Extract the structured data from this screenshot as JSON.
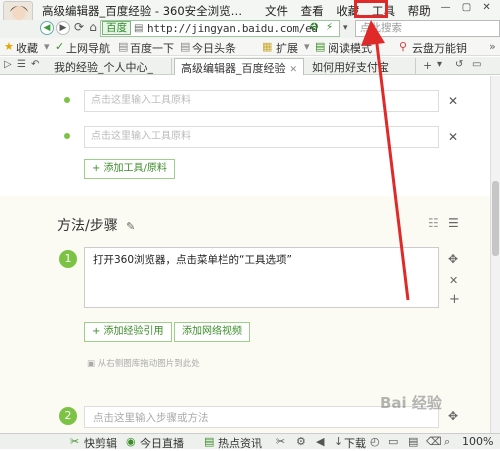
{
  "window": {
    "title": "高级编辑器_百度经验 - 360安全浏览…",
    "menu": [
      "文件",
      "查看",
      "收藏",
      "工具",
      "帮助"
    ],
    "controls": "▭ — ▢ ✕"
  },
  "address_bar": {
    "site_tag": "百度",
    "url": "http://jingyan.baidu.com/ed",
    "search_placeholder": "点此搜索"
  },
  "bookmarks": {
    "favorites": "收藏",
    "items": [
      "上网导航",
      "百度一下",
      "今日头条"
    ],
    "extensions": "扩展",
    "reading_mode": "阅读模式",
    "cloud": "云盘万能钥"
  },
  "tabs": [
    {
      "label": "我的经验_个人中心_"
    },
    {
      "label": "高级编辑器_百度经验",
      "active": true
    },
    {
      "label": "如何用好支付宝"
    }
  ],
  "editor": {
    "tool_placeholder": "点击这里输入工具原料",
    "add_tool": "+ 添加工具/原料",
    "method_title": "方法/步骤",
    "steps": [
      {
        "num": "1",
        "text": "打开360浏览器，点击菜单栏的“工具选项”"
      },
      {
        "num": "2",
        "placeholder": "点击这里输入步骤或方法"
      }
    ],
    "add_reference": "+ 添加经验引用",
    "add_video": "添加网络视频",
    "drag_hint": "从右侧图库拖动图片到此处"
  },
  "status_bar": {
    "items": [
      "快剪辑",
      "今日直播",
      "热点资讯"
    ],
    "download": "下载",
    "zoom": "100%"
  },
  "watermark": "Bai 经验",
  "colors": {
    "accent_green": "#7cc243",
    "highlight_red": "#e02a2a"
  }
}
